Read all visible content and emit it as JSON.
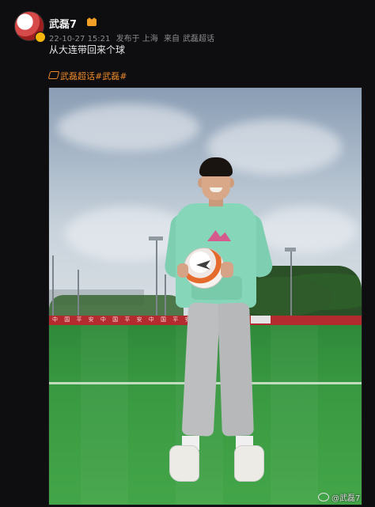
{
  "user": {
    "name": "武磊7",
    "verified_icon": "vip-crown-icon"
  },
  "post": {
    "time": "22-10-27 15:21",
    "location": "发布于 上海",
    "source_prefix": "来自",
    "source": "武磊超话",
    "text": "从大连带回来个球",
    "topic_link": "武磊超话#武磊#"
  },
  "photo": {
    "watermark": "@武磊7",
    "hoarding_text": "中 国 平 安   中 国 平 安   中 国 平 安"
  },
  "colors": {
    "background": "#0e0e10",
    "accent": "#f08a2b",
    "meta_text": "#8d8d8f"
  }
}
